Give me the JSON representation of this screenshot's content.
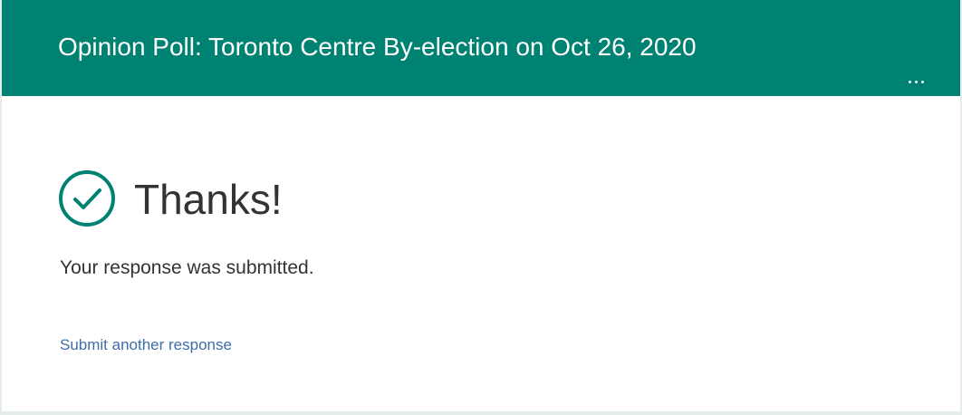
{
  "form": {
    "title": "Opinion Poll: Toronto Centre By-election on Oct 26, 2020"
  },
  "header": {
    "more_icon": "ellipsis-horizontal-icon"
  },
  "confirmation": {
    "icon": "checkmark-circle-icon",
    "heading": "Thanks!",
    "message": "Your response was submitted.",
    "submit_another_label": "Submit another response"
  },
  "colors": {
    "accent": "#008272",
    "link": "#3d6ea8",
    "text": "#333333",
    "background": "#e4ecec"
  }
}
